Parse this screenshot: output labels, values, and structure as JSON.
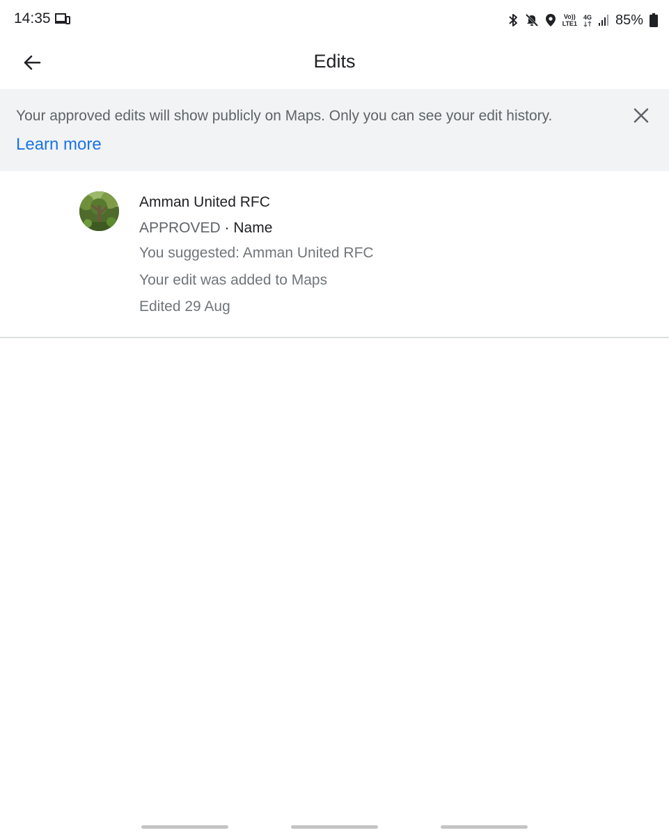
{
  "status_bar": {
    "time": "14:35",
    "icons": [
      "cast-icon",
      "bluetooth-icon",
      "mute-icon",
      "location-icon",
      "volte-icon",
      "4g-icon",
      "signal-icon",
      "battery-icon"
    ],
    "volte_top": "Vo))",
    "volte_bottom": "LTE1",
    "network_type": "4G",
    "battery_percent": "85%"
  },
  "app_bar": {
    "title": "Edits"
  },
  "banner": {
    "text": "Your approved edits will show publicly on Maps. Only you can see your edit history.",
    "link_label": "Learn more"
  },
  "edits": [
    {
      "place_name": "Amman United RFC",
      "status": "APPROVED",
      "separator": " · ",
      "field": "Name",
      "suggestion": "You suggested: Amman United RFC",
      "result": "Your edit was added to Maps",
      "date": "Edited 29 Aug"
    }
  ],
  "colors": {
    "accent": "#1a73e8",
    "banner_background": "#f1f3f4",
    "secondary_text": "#5f6368"
  }
}
